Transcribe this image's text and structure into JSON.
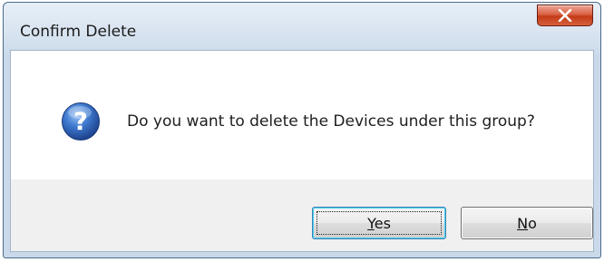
{
  "window": {
    "title": "Confirm Delete",
    "close_icon": "close-x-icon"
  },
  "message": {
    "icon": "question-icon",
    "text": "Do you want to delete the Devices under this group?"
  },
  "buttons": {
    "yes": {
      "mnemonic": "Y",
      "rest": "es"
    },
    "no": {
      "mnemonic": "N",
      "rest": "o"
    }
  },
  "colors": {
    "close_button": "#c43a17",
    "question_icon": "#2f64b3",
    "default_button_border": "#3c7fb1"
  }
}
